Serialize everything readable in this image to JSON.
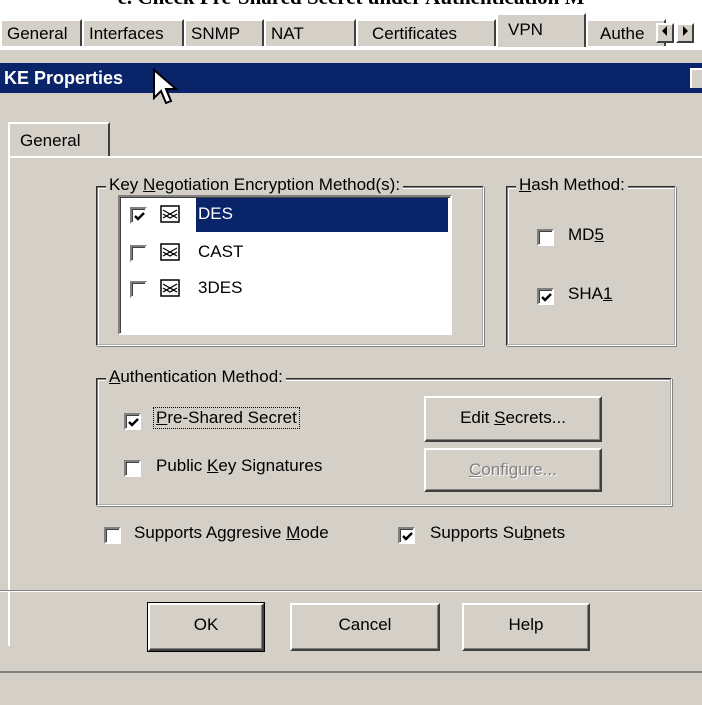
{
  "caption": "c. Check Pre-Shared Secret under Authentication M",
  "top_tabs": [
    {
      "label": "General",
      "active": false
    },
    {
      "label": "Interfaces",
      "active": false
    },
    {
      "label": "SNMP",
      "active": false
    },
    {
      "label": "NAT",
      "active": false
    },
    {
      "label": "Certificates",
      "active": false
    },
    {
      "label": "VPN",
      "active": true
    },
    {
      "label": "Authe",
      "active": false
    }
  ],
  "tab_scroll": {
    "left_icon": "arrow-left-icon",
    "right_icon": "arrow-right-icon"
  },
  "dialog": {
    "title": "KE Properties",
    "tab_label": "General",
    "encryption": {
      "legend_pre": "Key ",
      "legend_u": "N",
      "legend_post": "egotiation Encryption Method(s):",
      "items": [
        {
          "label": "DES",
          "checked": true,
          "selected": true
        },
        {
          "label": "CAST",
          "checked": false,
          "selected": false
        },
        {
          "label": "3DES",
          "checked": false,
          "selected": false
        }
      ]
    },
    "hash": {
      "legend_u": "H",
      "legend_post": "ash Method:",
      "md5": {
        "pre": "MD",
        "u": "5",
        "checked": false
      },
      "sha1": {
        "pre": "SHA",
        "u": "1",
        "checked": true
      }
    },
    "auth": {
      "legend_u": "A",
      "legend_post": "uthentication Method:",
      "pre_shared": {
        "u": "P",
        "post": "re-Shared Secret",
        "checked": true
      },
      "public_key": {
        "pre": "Public ",
        "u": "K",
        "post": "ey Signatures",
        "checked": false
      },
      "edit_secrets": {
        "pre": "Edit ",
        "u": "S",
        "post": "ecrets..."
      },
      "configure": {
        "u": "C",
        "post": "onfigure..."
      }
    },
    "aggressive": {
      "pre": "Supports Aggresive ",
      "u": "M",
      "post": "ode",
      "checked": false
    },
    "subnets": {
      "pre": "Supports Su",
      "u": "b",
      "post": "nets",
      "checked": true
    },
    "buttons": {
      "ok": "OK",
      "cancel": "Cancel",
      "help": "Help"
    }
  },
  "colors": {
    "title_bar": "#0a246a",
    "face": "#d4d0c8",
    "selection": "#0a246a"
  }
}
